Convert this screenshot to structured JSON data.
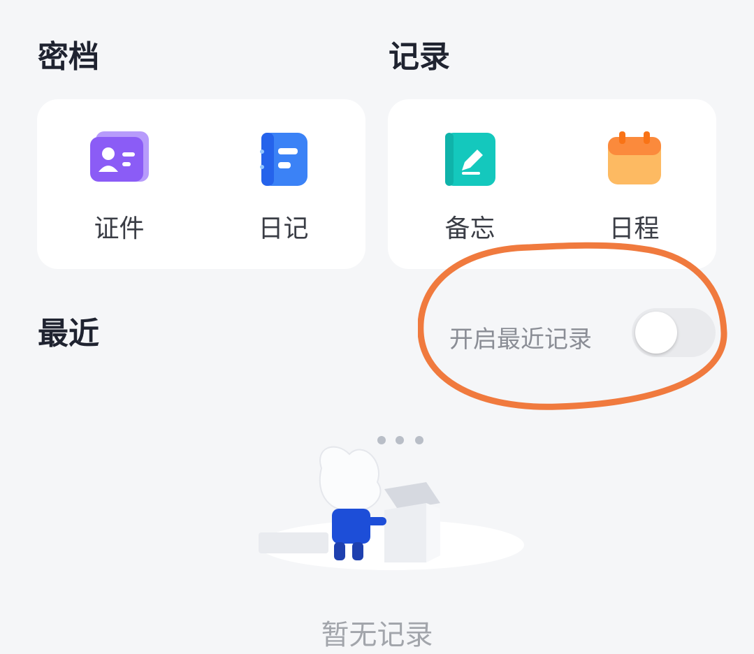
{
  "sections": {
    "archive": {
      "title": "密档",
      "items": [
        {
          "label": "证件",
          "icon": "id-card-icon",
          "color": "#8b5cf6"
        },
        {
          "label": "日记",
          "icon": "diary-icon",
          "color": "#3b82f6"
        }
      ]
    },
    "records": {
      "title": "记录",
      "items": [
        {
          "label": "备忘",
          "icon": "memo-icon",
          "color": "#14c8bd"
        },
        {
          "label": "日程",
          "icon": "calendar-icon",
          "color": "#fb923c"
        }
      ]
    },
    "recent": {
      "title": "最近",
      "toggle_label": "开启最近记录",
      "toggle_on": false,
      "empty_text": "暂无记录"
    }
  },
  "colors": {
    "background": "#f5f6f8",
    "annotation": "#f07a3e"
  }
}
